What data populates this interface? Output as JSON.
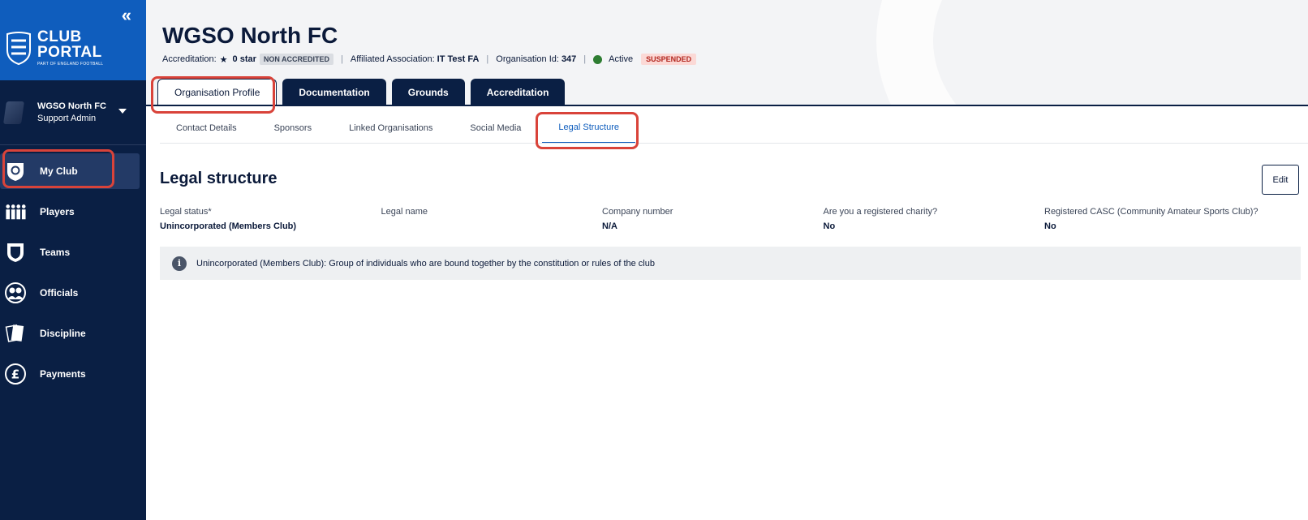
{
  "sidebar": {
    "collapse_icon": "«",
    "logo": {
      "title_line1": "CLUB",
      "title_line2": "PORTAL",
      "subtitle": "PART OF ENGLAND FOOTBALL"
    },
    "user": {
      "name": "WGSO North FC",
      "role": "Support Admin"
    },
    "nav": [
      {
        "label": "My Club",
        "icon": "shield-ball-icon",
        "active": true
      },
      {
        "label": "Players",
        "icon": "players-icon"
      },
      {
        "label": "Teams",
        "icon": "shield-icon"
      },
      {
        "label": "Officials",
        "icon": "officials-icon"
      },
      {
        "label": "Discipline",
        "icon": "cards-icon"
      },
      {
        "label": "Payments",
        "icon": "pound-icon"
      }
    ]
  },
  "header": {
    "title": "WGSO North FC",
    "accreditation_label": "Accreditation:",
    "accreditation_value": "0 star",
    "accreditation_badge": "NON ACCREDITED",
    "affiliated_label": "Affiliated Association:",
    "affiliated_value": "IT Test FA",
    "org_id_label": "Organisation Id:",
    "org_id_value": "347",
    "status": "Active",
    "status_badge": "SUSPENDED"
  },
  "tabs": [
    {
      "label": "Organisation Profile",
      "active": true
    },
    {
      "label": "Documentation"
    },
    {
      "label": "Grounds"
    },
    {
      "label": "Accreditation"
    }
  ],
  "subtabs": [
    {
      "label": "Contact Details"
    },
    {
      "label": "Sponsors"
    },
    {
      "label": "Linked Organisations"
    },
    {
      "label": "Social Media"
    },
    {
      "label": "Legal Structure",
      "active": true
    }
  ],
  "section": {
    "title": "Legal structure",
    "edit_label": "Edit",
    "fields": [
      {
        "label": "Legal status*",
        "value": "Unincorporated (Members Club)"
      },
      {
        "label": "Legal name",
        "value": ""
      },
      {
        "label": "Company number",
        "value": "N/A"
      },
      {
        "label": "Are you a registered charity?",
        "value": "No"
      },
      {
        "label": "Registered CASC (Community Amateur Sports Club)?",
        "value": "No"
      }
    ],
    "info_text": "Unincorporated (Members Club): Group of individuals who are bound together by the constitution or rules of the club"
  },
  "colors": {
    "sidebar": "#0a1f44",
    "logo_bg": "#0f5dbd",
    "accent": "#0f5dbd",
    "highlight": "#d9433a",
    "active_green": "#2e7d32"
  }
}
